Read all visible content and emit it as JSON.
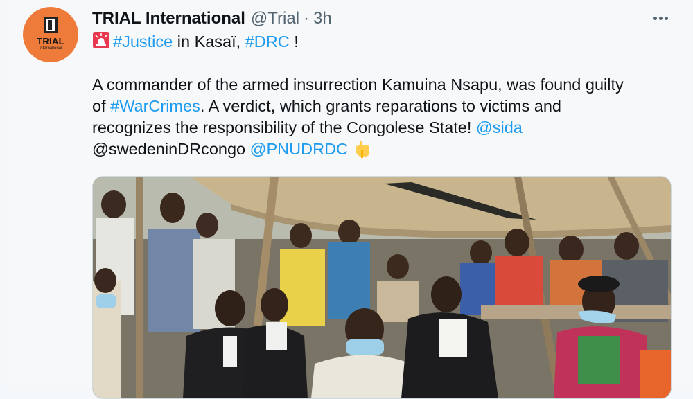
{
  "tweet": {
    "avatar_text": "TRIAL",
    "avatar_subtext": "International",
    "display_name": "TRIAL International",
    "handle": "@Trial",
    "separator": "·",
    "time": "3h",
    "line1": {
      "hashtag_justice": "#Justice",
      "text_kasai": " in Kasaï, ",
      "hashtag_drc": "#DRC",
      "text_end": " !"
    },
    "line2": "A commander of the armed insurrection Kamuina Nsapu, was found guilty",
    "line3": {
      "text_of": "of ",
      "hashtag_warcrimes": "#WarCrimes",
      "text_rest": ". A verdict, which grants reparations to victims and"
    },
    "line4": {
      "text": "recognizes the responsibility of the Congolese State! ",
      "mention_sida": "@sida"
    },
    "line5": {
      "mention_sweden": "@swedeninDRcongo",
      "space": " ",
      "mention_pnud": "@PNUDRDC"
    },
    "icons": {
      "siren": "rotating-light-emoji",
      "hand": "pointing-down-emoji",
      "more": "more-dots-icon"
    },
    "colors": {
      "link": "#1d9bf0",
      "avatar_bg": "#ee7b3a"
    }
  }
}
